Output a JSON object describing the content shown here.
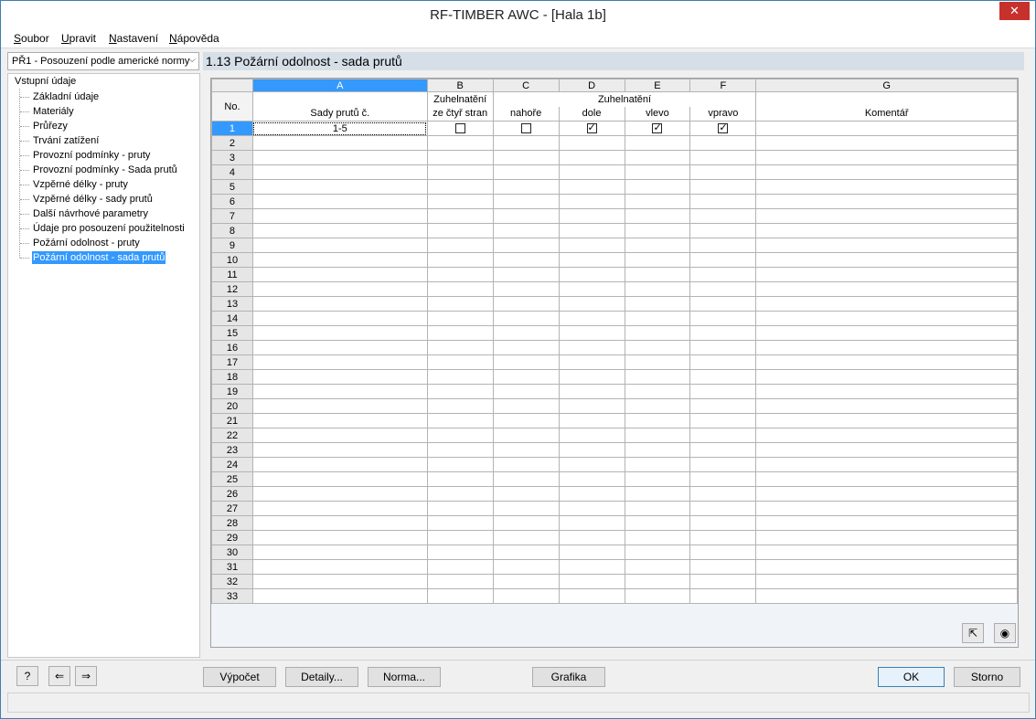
{
  "window": {
    "title": "RF-TIMBER AWC - [Hala 1b]"
  },
  "menu": [
    "Soubor",
    "Upravit",
    "Nastavení",
    "Nápověda"
  ],
  "case_selector": {
    "value": "PŘ1 - Posouzení podle americké normy"
  },
  "tree": {
    "root": "Vstupní údaje",
    "items": [
      "Základní údaje",
      "Materiály",
      "Průřezy",
      "Trvání zatížení",
      "Provozní podmínky - pruty",
      "Provozní podmínky - Sada prutů",
      "Vzpěrné délky - pruty",
      "Vzpěrné délky - sady prutů",
      "Další návrhové parametry",
      "Údaje pro posouzení použitelnosti",
      "Požární odolnost - pruty",
      "Požární odolnost - sada prutů"
    ],
    "selected_index": 11
  },
  "section_title": "1.13 Požární odolnost - sada prutů",
  "grid": {
    "column_letters": [
      "A",
      "B",
      "C",
      "D",
      "E",
      "F",
      "G"
    ],
    "no_label": "No.",
    "header_a": "Sady prutů č.",
    "header_b_top": "Zuhelnatění",
    "header_b_bottom": "ze čtyř stran",
    "header_group_top": "Zuhelnatění",
    "header_c": "nahoře",
    "header_d": "dole",
    "header_e": "vlevo",
    "header_f": "vpravo",
    "header_g": "Komentář",
    "row_count": 33,
    "rows": [
      {
        "no": "1",
        "members": "1-5",
        "four_sides": false,
        "top": false,
        "bottom": true,
        "left": true,
        "right": true,
        "comment": ""
      }
    ]
  },
  "buttons": {
    "calc": "Výpočet",
    "details": "Detaily...",
    "norm": "Norma...",
    "graphics": "Grafika",
    "ok": "OK",
    "cancel": "Storno"
  }
}
